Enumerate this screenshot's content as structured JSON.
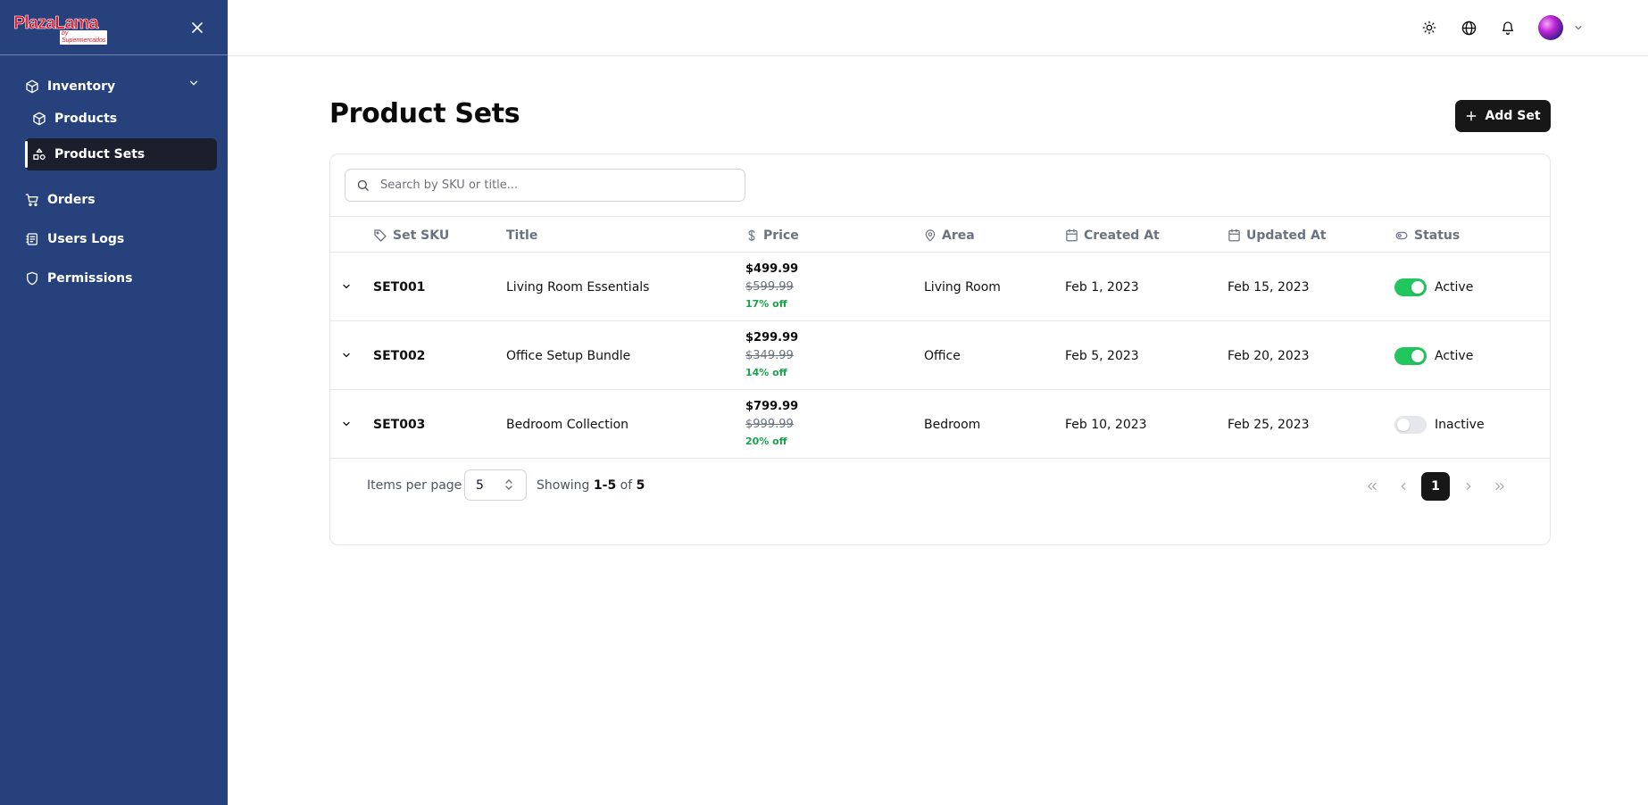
{
  "brand": {
    "logo_text": "PlazaLama",
    "logo_sub": "by Supermercados"
  },
  "sidebar": {
    "items": [
      {
        "label": "Inventory",
        "icon": "box-icon"
      },
      {
        "label": "Products",
        "icon": "box-icon"
      },
      {
        "label": "Product Sets",
        "icon": "shapes-icon"
      },
      {
        "label": "Orders",
        "icon": "cart-icon"
      },
      {
        "label": "Users Logs",
        "icon": "logs-icon"
      },
      {
        "label": "Permissions",
        "icon": "shield-icon"
      }
    ]
  },
  "header": {
    "icons": [
      "sun-icon",
      "globe-icon",
      "bell-icon",
      "avatar",
      "chevron-down-icon"
    ]
  },
  "page": {
    "title": "Product Sets",
    "add_button_label": "Add Set"
  },
  "search": {
    "placeholder": "Search by SKU or title..."
  },
  "table": {
    "columns": [
      {
        "label": "Set SKU",
        "icon": "tag-icon"
      },
      {
        "label": "Title",
        "icon": ""
      },
      {
        "label": "Price",
        "icon": "dollar-icon"
      },
      {
        "label": "Area",
        "icon": "map-pin-icon"
      },
      {
        "label": "Created At",
        "icon": "calendar-icon"
      },
      {
        "label": "Updated At",
        "icon": "calendar-icon"
      },
      {
        "label": "Status",
        "icon": "toggle-icon"
      }
    ],
    "rows": [
      {
        "sku": "SET001",
        "title": "Living Room Essentials",
        "price": "$499.99",
        "old_price": "$599.99",
        "discount": "17% off",
        "area": "Living Room",
        "created": "Feb 1, 2023",
        "updated": "Feb 15, 2023",
        "active": true,
        "status": "Active"
      },
      {
        "sku": "SET002",
        "title": "Office Setup Bundle",
        "price": "$299.99",
        "old_price": "$349.99",
        "discount": "14% off",
        "area": "Office",
        "created": "Feb 5, 2023",
        "updated": "Feb 20, 2023",
        "active": true,
        "status": "Active"
      },
      {
        "sku": "SET003",
        "title": "Bedroom Collection",
        "price": "$799.99",
        "old_price": "$999.99",
        "discount": "20% off",
        "area": "Bedroom",
        "created": "Feb 10, 2023",
        "updated": "Feb 25, 2023",
        "active": false,
        "status": "Inactive"
      }
    ]
  },
  "pagination": {
    "items_per_page_label": "Items per page",
    "items_per_page": "5",
    "showing_prefix": "Showing",
    "showing_range": "1-5",
    "showing_of": "of",
    "showing_total": "5",
    "current_page": "1"
  },
  "colors": {
    "sidebar_bg": "#26417b",
    "active_item_bg": "#1a1f2b",
    "primary_button": "#171717",
    "success": "#22c55e",
    "discount_text": "#16a34a"
  }
}
